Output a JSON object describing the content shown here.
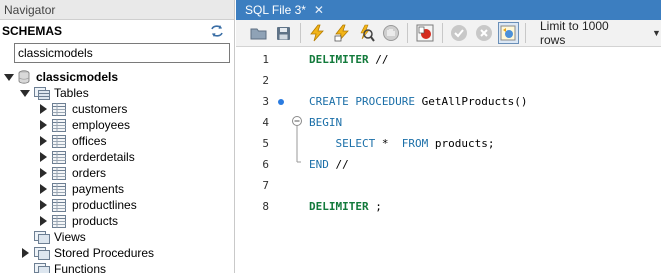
{
  "navigator": {
    "title": "Navigator",
    "schemas_label": "SCHEMAS",
    "search_value": "classicmodels",
    "schema_name": "classicmodels",
    "tables_label": "Tables",
    "tables": [
      "customers",
      "employees",
      "offices",
      "orderdetails",
      "orders",
      "payments",
      "productlines",
      "products"
    ],
    "views_label": "Views",
    "stored_procedures_label": "Stored Procedures",
    "functions_label": "Functions"
  },
  "editor": {
    "tab_label": "SQL File 3*",
    "tab_close": "✕",
    "limit_label": "Limit to 1000 rows",
    "toolbar_icons": [
      "open-folder-icon",
      "save-icon",
      "execute-icon",
      "execute-current-icon",
      "explain-icon",
      "stop-icon",
      "toggle-stop-on-error-icon",
      "commit-icon",
      "rollback-icon",
      "toggle-autocommit-icon"
    ],
    "lines": [
      {
        "no": "1",
        "segments": [
          {
            "text": "DELIMITER",
            "style": "kw-bold"
          },
          {
            "text": " //",
            "style": "plain"
          }
        ]
      },
      {
        "no": "2",
        "segments": []
      },
      {
        "no": "3",
        "segments": [
          {
            "text": "CREATE PROCEDURE",
            "style": "kw"
          },
          {
            "text": " GetAllProducts()",
            "style": "plain"
          }
        ]
      },
      {
        "no": "4",
        "segments": [
          {
            "text": "BEGIN",
            "style": "kw"
          }
        ]
      },
      {
        "no": "5",
        "segments": [
          {
            "text": "    SELECT",
            "style": "kw"
          },
          {
            "text": " *  ",
            "style": "plain"
          },
          {
            "text": "FROM",
            "style": "kw"
          },
          {
            "text": " products;",
            "style": "plain"
          }
        ]
      },
      {
        "no": "6",
        "segments": [
          {
            "text": "END",
            "style": "kw"
          },
          {
            "text": " //",
            "style": "plain"
          }
        ]
      },
      {
        "no": "7",
        "segments": []
      },
      {
        "no": "8",
        "segments": [
          {
            "text": "DELIMITER",
            "style": "kw-bold"
          },
          {
            "text": " ;",
            "style": "plain"
          }
        ]
      }
    ]
  },
  "colors": {
    "tab_blue": "#3c7ec0",
    "keyword": "#1b6fa8",
    "delimiter": "#127a3b",
    "marker": "#2a7be0"
  }
}
